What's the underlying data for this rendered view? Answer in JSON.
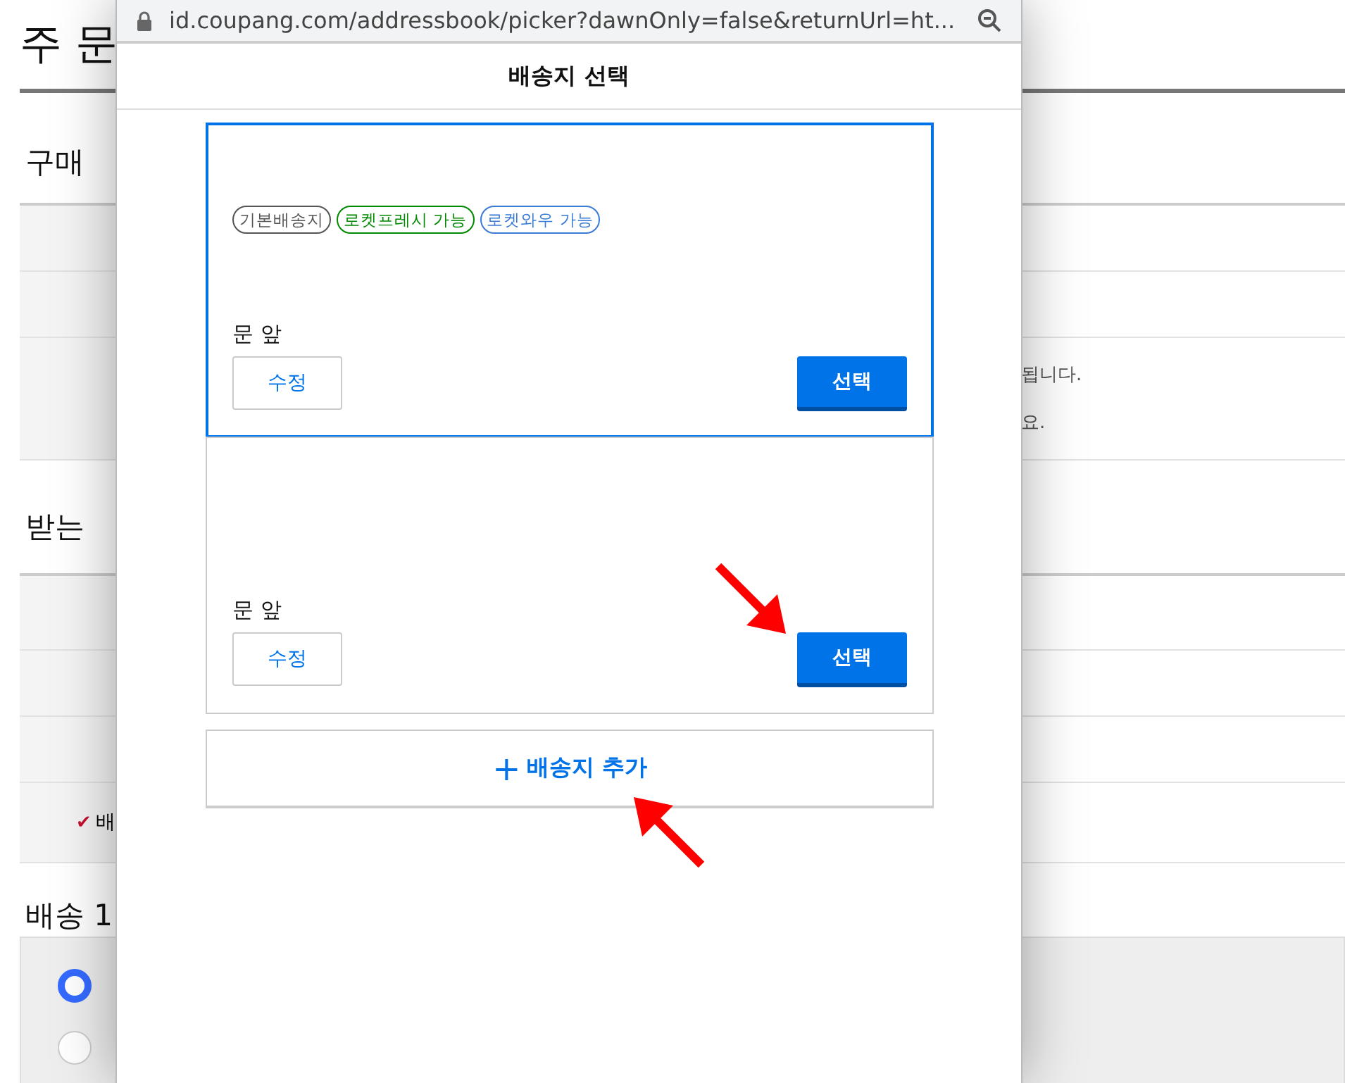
{
  "page": {
    "title": "주 문",
    "buyer": {
      "heading": "구매",
      "rows": [
        {
          "label": "",
          "lines": []
        },
        {
          "label": "",
          "lines": []
        },
        {
          "label": "",
          "lines": [
            "됩니다.",
            "요."
          ]
        }
      ]
    },
    "recipient": {
      "heading": "받는",
      "rows": [
        {
          "label": ""
        },
        {
          "label": ""
        },
        {
          "label": ""
        },
        {
          "label": "배",
          "check": "✔",
          "checked": true
        }
      ]
    },
    "delivery": {
      "heading": "배송 1",
      "options": [
        {
          "selected": true
        },
        {
          "selected": false
        }
      ]
    }
  },
  "popup": {
    "url": "id.coupang.com/addressbook/picker?dawnOnly=false&returnUrl=ht...",
    "title": "배송지 선택",
    "addresses": [
      {
        "selected": true,
        "tags": [
          {
            "label": "기본배송지",
            "color": "#555555"
          },
          {
            "label": "로켓프레시 가능",
            "color": "#008a00"
          },
          {
            "label": "로켓와우 가능",
            "color": "#3a7bd5"
          }
        ],
        "note": "문 앞",
        "edit": "수정",
        "choose": "선택",
        "arrow": false
      },
      {
        "selected": false,
        "note": "문 앞",
        "edit": "수정",
        "choose": "선택",
        "arrow": true
      }
    ],
    "add_button": {
      "icon": "+",
      "label": "배송지 추가",
      "arrow": true
    }
  }
}
